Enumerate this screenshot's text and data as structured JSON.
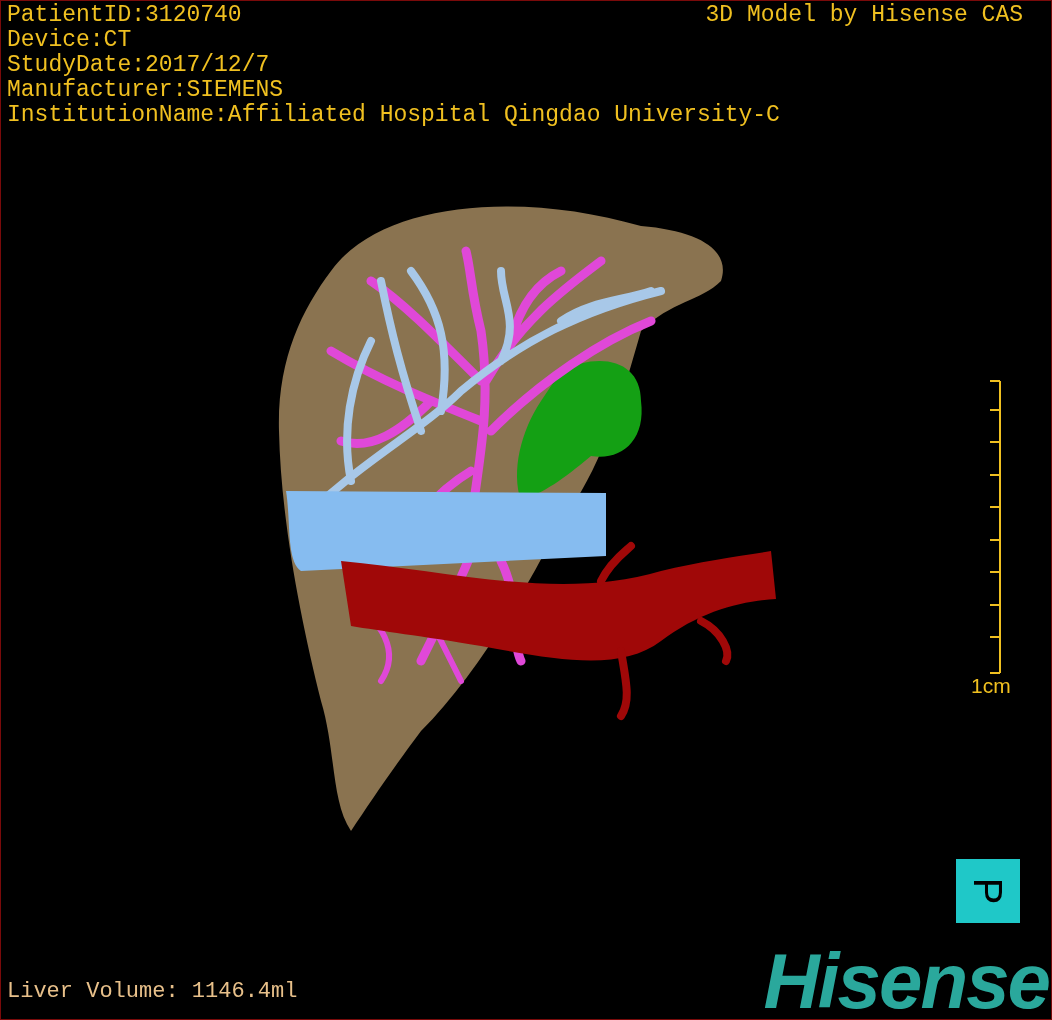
{
  "overlay": {
    "patient_info": [
      "PatientID:3120740",
      "Device:CT",
      "StudyDate:2017/12/7",
      "Manufacturer:SIEMENS",
      "InstitutionName:Affiliated Hospital Qingdao University-C"
    ],
    "title": "3D Model by Hisense CAS",
    "scale_label": "1cm",
    "measurement": "Liver Volume: 1146.4ml",
    "orientation_marker": "P",
    "logo": "Hisense"
  }
}
